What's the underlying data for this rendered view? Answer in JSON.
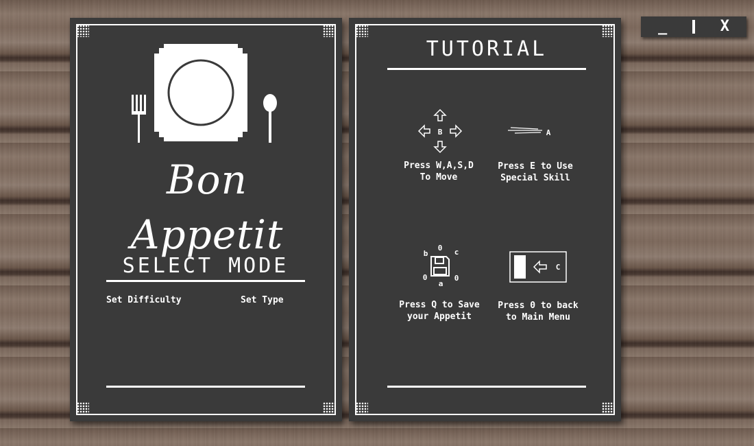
{
  "window_controls": {
    "minimize": "_",
    "close": "X"
  },
  "left_card": {
    "brand": "Bon Appetit",
    "heading": "SELECT MODE",
    "options": [
      "Set Difficulty",
      "Set Type"
    ]
  },
  "right_card": {
    "heading": "TUTORIAL",
    "items": [
      {
        "icon": "arrow-keys-icon",
        "key_label": "B",
        "line1": "Press W,A,S,D",
        "line2": "To Move"
      },
      {
        "icon": "speed-lines-icon",
        "key_label": "A",
        "line1": "Press E to Use",
        "line2": "Special Skill"
      },
      {
        "icon": "floppy-disk-icon",
        "key_labels": {
          "top": "0",
          "left": "b",
          "right": "c",
          "bottom_left": "0",
          "bottom": "a",
          "bottom_right": "0"
        },
        "line1": "Press Q to Save",
        "line2": "your Appetit"
      },
      {
        "icon": "back-door-icon",
        "key_label": "C",
        "line1": "Press 0 to back",
        "line2": "to Main Menu"
      }
    ]
  },
  "colors": {
    "card": "#3a3a3a",
    "ink": "#ffffff"
  }
}
